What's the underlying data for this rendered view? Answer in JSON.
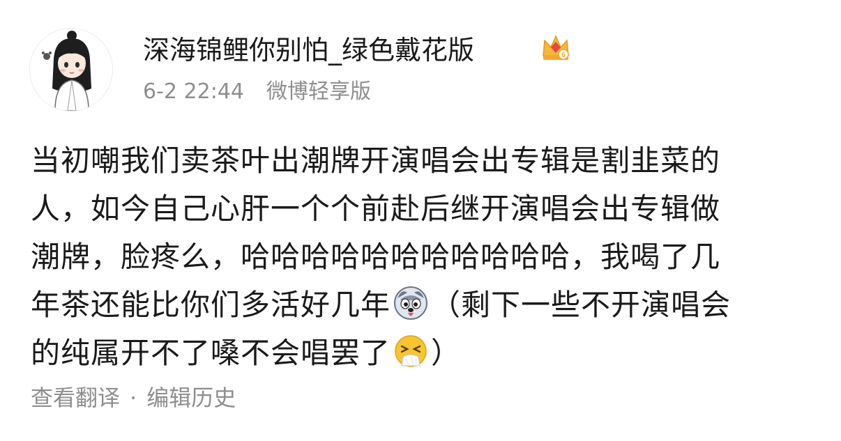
{
  "post": {
    "author": {
      "name": "深海锦鲤你别怕_绿色戴花版",
      "badge": "crown-vip-badge",
      "avatar": "avatar-cartoon-character"
    },
    "meta": {
      "time": "6-2 22:44",
      "source": "微博轻享版"
    },
    "content": {
      "line1": "当初嘲我们卖茶叶出潮牌开演唱会出专辑是割韭菜的",
      "line2": "人，如今自己心肝一个个前赴后继开演唱会出专辑做",
      "line3": "潮牌，脸疼么，哈哈哈哈哈哈哈哈哈哈哈，我喝了几",
      "line4_a": "年茶还能比你们多活好几年",
      "line4_b": "（剩下一些不开演唱会",
      "line5_a": "的纯属开不了嗓不会唱罢了",
      "line5_b": "）",
      "emoji_1": "husky-dog-emoji",
      "emoji_2": "sneezing-face-emoji"
    },
    "footer": {
      "translate": "查看翻译",
      "dot": "·",
      "edit_history": "编辑历史"
    }
  }
}
